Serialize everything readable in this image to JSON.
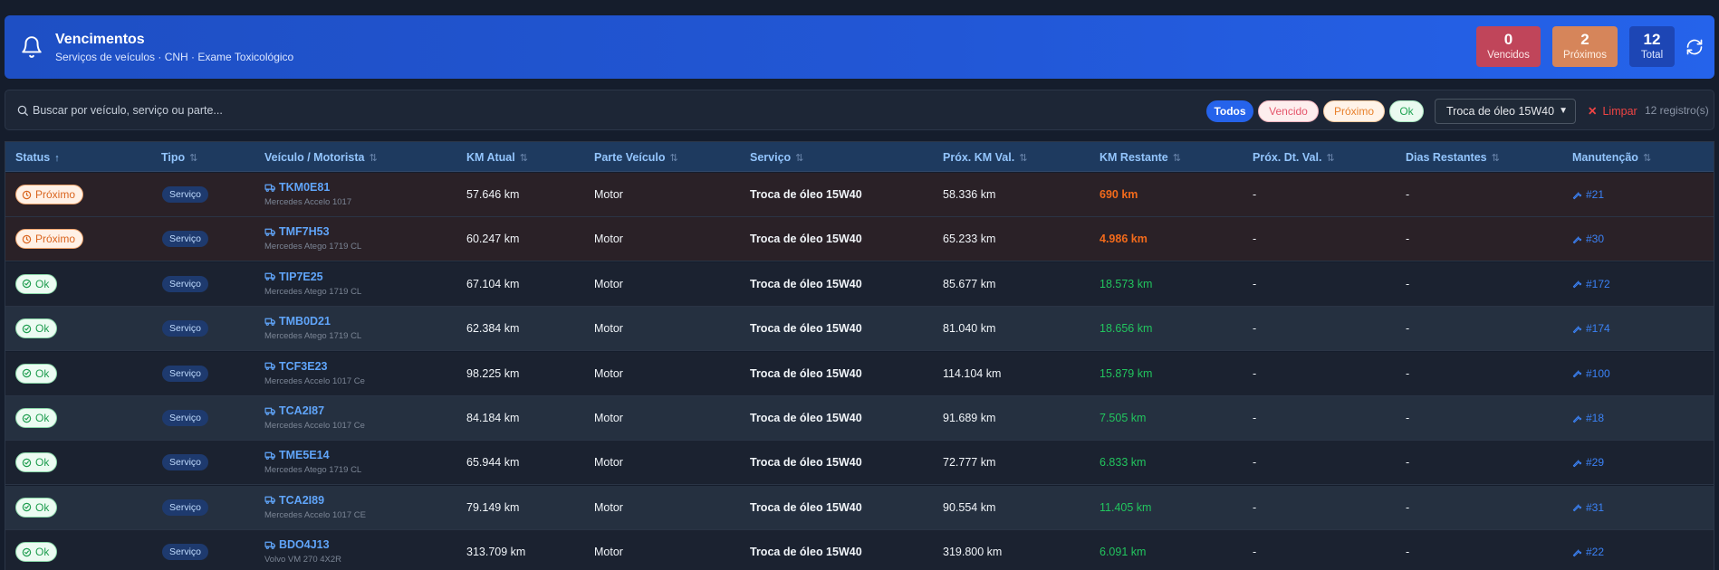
{
  "header": {
    "title": "Vencimentos",
    "subtitle": "Serviços de veículos · CNH · Exame Toxicológico",
    "stats": {
      "vencidos": {
        "value": "0",
        "label": "Vencidos",
        "color": "#c0455a"
      },
      "proximos": {
        "value": "2",
        "label": "Próximos",
        "color": "#d6855a"
      },
      "total": {
        "value": "12",
        "label": "Total",
        "color": "#1d46b5"
      }
    }
  },
  "toolbar": {
    "search_placeholder": "Buscar por veículo, serviço ou parte...",
    "filters": {
      "todos": "Todos",
      "vencido": "Vencido",
      "proximo": "Próximo",
      "ok": "Ok"
    },
    "selected_filter": "Todos",
    "service_select": "Troca de óleo 15W40",
    "clear_label": "Limpar",
    "count": "12 registro(s)"
  },
  "table": {
    "columns": {
      "status": "Status",
      "tipo": "Tipo",
      "veiculo": "Veículo / Motorista",
      "km_atual": "KM Atual",
      "parte": "Parte Veículo",
      "servico": "Serviço",
      "prox_km": "Próx. KM Val.",
      "km_restante": "KM Restante",
      "prox_dt": "Próx. Dt. Val.",
      "dias": "Dias Restantes",
      "manutencao": "Manutenção"
    },
    "sorted_by": "Status",
    "rows": [
      {
        "status": "Próximo",
        "tipo": "Serviço",
        "placa": "TKM0E81",
        "modelo": "Mercedes Accelo 1017",
        "km_atual": "57.646 km",
        "parte": "Motor",
        "servico": "Troca de óleo 15W40",
        "prox_km": "58.336 km",
        "km_restante": "690 km",
        "prox_dt": "-",
        "dias": "-",
        "manutencao": "#21"
      },
      {
        "status": "Próximo",
        "tipo": "Serviço",
        "placa": "TMF7H53",
        "modelo": "Mercedes Atego 1719 CL",
        "km_atual": "60.247 km",
        "parte": "Motor",
        "servico": "Troca de óleo 15W40",
        "prox_km": "65.233 km",
        "km_restante": "4.986 km",
        "prox_dt": "-",
        "dias": "-",
        "manutencao": "#30"
      },
      {
        "status": "Ok",
        "tipo": "Serviço",
        "placa": "TIP7E25",
        "modelo": "Mercedes Atego 1719 CL",
        "km_atual": "67.104 km",
        "parte": "Motor",
        "servico": "Troca de óleo 15W40",
        "prox_km": "85.677 km",
        "km_restante": "18.573 km",
        "prox_dt": "-",
        "dias": "-",
        "manutencao": "#172"
      },
      {
        "status": "Ok",
        "tipo": "Serviço",
        "placa": "TMB0D21",
        "modelo": "Mercedes Atego 1719 CL",
        "km_atual": "62.384 km",
        "parte": "Motor",
        "servico": "Troca de óleo 15W40",
        "prox_km": "81.040 km",
        "km_restante": "18.656 km",
        "prox_dt": "-",
        "dias": "-",
        "manutencao": "#174"
      },
      {
        "status": "Ok",
        "tipo": "Serviço",
        "placa": "TCF3E23",
        "modelo": "Mercedes Accelo 1017 Ce",
        "km_atual": "98.225 km",
        "parte": "Motor",
        "servico": "Troca de óleo 15W40",
        "prox_km": "114.104 km",
        "km_restante": "15.879 km",
        "prox_dt": "-",
        "dias": "-",
        "manutencao": "#100"
      },
      {
        "status": "Ok",
        "tipo": "Serviço",
        "placa": "TCA2I87",
        "modelo": "Mercedes Accelo 1017 Ce",
        "km_atual": "84.184 km",
        "parte": "Motor",
        "servico": "Troca de óleo 15W40",
        "prox_km": "91.689 km",
        "km_restante": "7.505 km",
        "prox_dt": "-",
        "dias": "-",
        "manutencao": "#18"
      },
      {
        "status": "Ok",
        "tipo": "Serviço",
        "placa": "TME5E14",
        "modelo": "Mercedes Atego 1719 CL",
        "km_atual": "65.944 km",
        "parte": "Motor",
        "servico": "Troca de óleo 15W40",
        "prox_km": "72.777 km",
        "km_restante": "6.833 km",
        "prox_dt": "-",
        "dias": "-",
        "manutencao": "#29"
      },
      {
        "status": "Ok",
        "tipo": "Serviço",
        "placa": "TCA2I89",
        "modelo": "Mercedes Accelo 1017 CE",
        "km_atual": "79.149 km",
        "parte": "Motor",
        "servico": "Troca de óleo 15W40",
        "prox_km": "90.554 km",
        "km_restante": "11.405 km",
        "prox_dt": "-",
        "dias": "-",
        "manutencao": "#31"
      },
      {
        "status": "Ok",
        "tipo": "Serviço",
        "placa": "BDO4J13",
        "modelo": "Volvo VM 270 4X2R",
        "km_atual": "313.709 km",
        "parte": "Motor",
        "servico": "Troca de óleo 15W40",
        "prox_km": "319.800 km",
        "km_restante": "6.091 km",
        "prox_dt": "-",
        "dias": "-",
        "manutencao": "#22"
      }
    ]
  },
  "colors": {
    "accent": "#2563eb",
    "warning_text": "#f26a1b",
    "ok_text": "#22c55e",
    "link": "#3b82f6"
  }
}
